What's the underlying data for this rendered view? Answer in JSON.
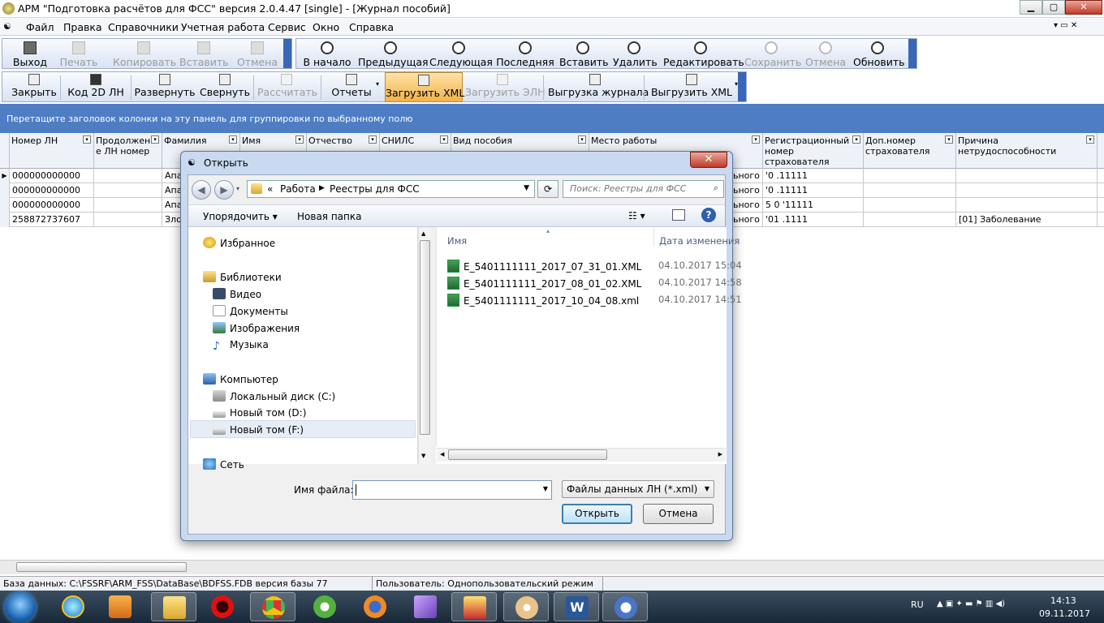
{
  "window": {
    "title": "АРМ \"Подготовка расчётов для ФСС\"  версия 2.0.4.47 [single] - [Журнал пособий]",
    "min": "▁",
    "max": "▢",
    "close": "✕"
  },
  "menu": {
    "items": [
      "Файл",
      "Правка",
      "Справочники",
      "Учетная работа",
      "Сервис",
      "Окно",
      "Справка"
    ]
  },
  "toolbar1": {
    "left": [
      "Выход",
      "Печать",
      "Копировать",
      "Вставить",
      "Отмена"
    ],
    "right": [
      "В начало",
      "Предыдущая",
      "Следующая",
      "Последняя",
      "Вставить",
      "Удалить",
      "Редактировать",
      "Сохранить",
      "Отмена",
      "Обновить"
    ]
  },
  "toolbar2": {
    "buttons": [
      "Закрыть",
      "Код 2D  ЛН",
      "Развернуть",
      "Свернуть",
      "Рассчитать",
      "Отчеты",
      "Загрузить XML",
      "Загрузить ЭЛН",
      "Выгрузка журнала",
      "Выгрузить XML"
    ]
  },
  "group_panel": "Перетащите заголовок колонки на эту панель для группировки по выбранному полю",
  "grid": {
    "columns": [
      "Номер ЛН",
      "Продолжени е ЛН номер",
      "Фамилия",
      "Имя",
      "Отчество",
      "СНИЛС",
      "Вид пособия",
      "Место работы",
      "Регистрационный номер страхователя",
      "Доп.номер страхователя",
      "Причина нетрудоспособности"
    ],
    "rows": [
      {
        "num": "000000000000",
        "fam": "Апат",
        "place": "ьного",
        "reg": "'0   .11111",
        "reason": ""
      },
      {
        "num": "000000000000",
        "fam": "Апат",
        "place": "ьного",
        "reg": "'0   .11111",
        "reason": ""
      },
      {
        "num": "000000000000",
        "fam": "Апат",
        "place": "ьного",
        "reg": "5 0   '11111",
        "reason": ""
      },
      {
        "num": "258872737607",
        "fam": "Злоб",
        "place": "ьного",
        "reg": "'01   .1111",
        "reason": "[01] Заболевание"
      }
    ]
  },
  "statusbar": {
    "db": "База данных: C:\\FSSRF\\ARM_FSS\\DataBase\\BDFSS.FDB  версия базы 77",
    "user": "Пользователь: Однопользовательский режим"
  },
  "dialog": {
    "title": "Открыть",
    "path": [
      "Работа",
      "Реестры для ФСС"
    ],
    "search_placeholder": "Поиск: Реестры для ФСС",
    "organize": "Упорядочить",
    "new_folder": "Новая папка",
    "nav": {
      "favorites": "Избранное",
      "libraries": "Библиотеки",
      "video": "Видео",
      "documents": "Документы",
      "images": "Изображения",
      "music": "Музыка",
      "computer": "Компьютер",
      "disk_c": "Локальный диск (C:)",
      "disk_d": "Новый том (D:)",
      "disk_f": "Новый том (F:)",
      "network": "Сеть"
    },
    "col_name": "Имя",
    "col_date": "Дата изменения",
    "files": [
      {
        "name": "E_5401111111_2017_07_31_01.XML",
        "date": "04.10.2017 15:04"
      },
      {
        "name": "E_5401111111_2017_08_01_02.XML",
        "date": "04.10.2017 14:58"
      },
      {
        "name": "E_5401111111_2017_10_04_08.xml",
        "date": "04.10.2017 14:51"
      }
    ],
    "filename_label": "Имя файла:",
    "filename_value": "",
    "filetype": "Файлы данных ЛН (*.xml)",
    "open_btn": "Открыть",
    "cancel_btn": "Отмена"
  },
  "taskbar": {
    "lang": "RU",
    "time": "14:13",
    "date": "09.11.2017"
  },
  "colors": {
    "accent": "#4e7dc4",
    "selected_button": "#f7c77b"
  }
}
